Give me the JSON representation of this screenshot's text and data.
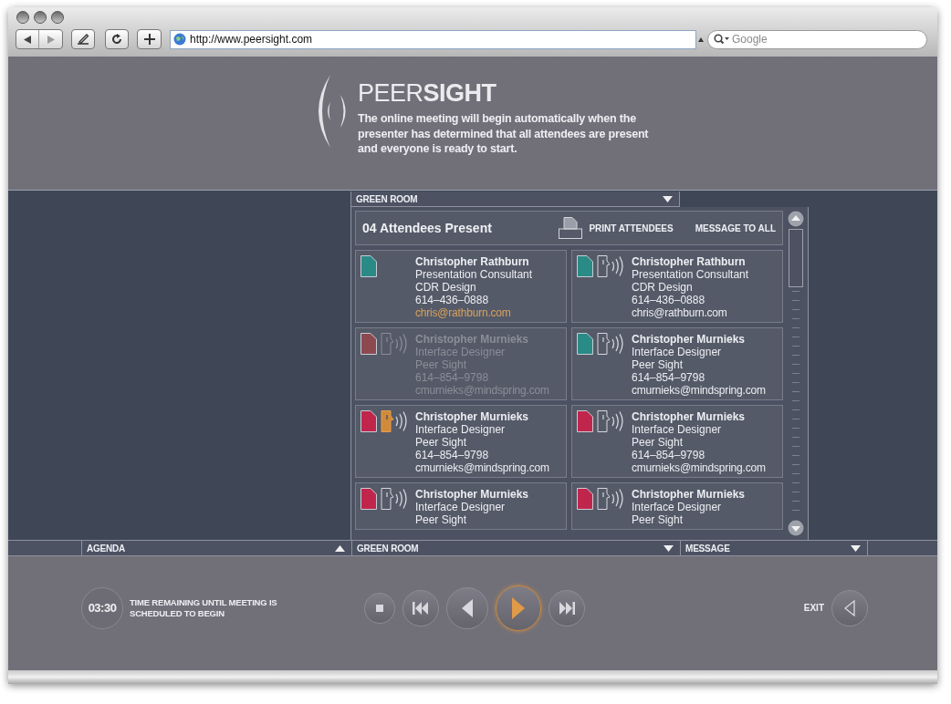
{
  "browser": {
    "url": "http://www.peersight.com",
    "search": {
      "placeholder": "Google"
    }
  },
  "brand": "PEER**SIGHT**",
  "intro": "The online meeting will begin automatically when the presenter has determined that all attendees are present and everyone is ready to start.",
  "room_tab": {
    "label": "GREEN ROOM"
  },
  "attendees": {
    "title": "04 Attendees Present",
    "print": "PRINT ATTENDEES",
    "message_all": "MESSAGE TO ALL",
    "cards": [
      {
        "name": "Christopher Rathburn",
        "role": "Presentation Consultant",
        "company": "CDR Design",
        "phone": "614–436–0888",
        "email": "chris@rathburn.com",
        "color": "#2a8a86",
        "speaker": false,
        "dimmed": false,
        "email_highlight": true
      },
      {
        "name": "Christopher Rathburn",
        "role": "Presentation Consultant",
        "company": "CDR Design",
        "phone": "614–436–0888",
        "email": "chris@rathburn.com",
        "color": "#2a8a86",
        "speaker": true,
        "speaking": false,
        "dimmed": false,
        "email_highlight": false
      },
      {
        "name": "Christopher Murnieks",
        "role": "Interface Designer",
        "company": "Peer Sight",
        "phone": "614–854–9798",
        "email": "cmurnieks@mindspring.com",
        "color": "#8c4a50",
        "speaker": true,
        "speaking": false,
        "dimmed": true,
        "email_highlight": false
      },
      {
        "name": "Christopher Murnieks",
        "role": "Interface Designer",
        "company": "Peer Sight",
        "phone": "614–854–9798",
        "email": "cmurnieks@mindspring.com",
        "color": "#2a8a86",
        "speaker": true,
        "speaking": false,
        "dimmed": false,
        "email_highlight": false
      },
      {
        "name": "Christopher Murnieks",
        "role": "Interface Designer",
        "company": "Peer Sight",
        "phone": "614–854–9798",
        "email": "cmurnieks@mindspring.com",
        "color": "#c0264c",
        "speaker": true,
        "speaking": true,
        "dimmed": false,
        "email_highlight": false
      },
      {
        "name": "Christopher Murnieks",
        "role": "Interface Designer",
        "company": "Peer Sight",
        "phone": "614–854–9798",
        "email": "cmurnieks@mindspring.com",
        "color": "#c0264c",
        "speaker": true,
        "speaking": false,
        "dimmed": false,
        "email_highlight": false
      },
      {
        "name": "Christopher Murnieks",
        "role": "Interface Designer",
        "company": "Peer Sight",
        "color": "#c0264c",
        "speaker": true,
        "speaking": false,
        "dimmed": false
      },
      {
        "name": "Christopher Murnieks",
        "role": "Interface Designer",
        "company": "Peer Sight",
        "color": "#c0264c",
        "speaker": true,
        "speaking": false,
        "dimmed": false
      }
    ]
  },
  "bottom_tabs": [
    {
      "label": "AGENDA",
      "caret_up": true
    },
    {
      "label": "GREEN ROOM",
      "caret_up": false
    },
    {
      "label": "MESSAGE",
      "caret_up": false
    }
  ],
  "timer": {
    "time": "03:30",
    "caption": "TIME REMAINING UNTIL MEETING IS SCHEDULED TO BEGIN"
  },
  "controls": [
    {
      "kind": "stop",
      "selected": false
    },
    {
      "kind": "first",
      "selected": false
    },
    {
      "kind": "back",
      "selected": false
    },
    {
      "kind": "play",
      "selected": true
    },
    {
      "kind": "last",
      "selected": false
    }
  ],
  "exit": {
    "label": "EXIT"
  }
}
